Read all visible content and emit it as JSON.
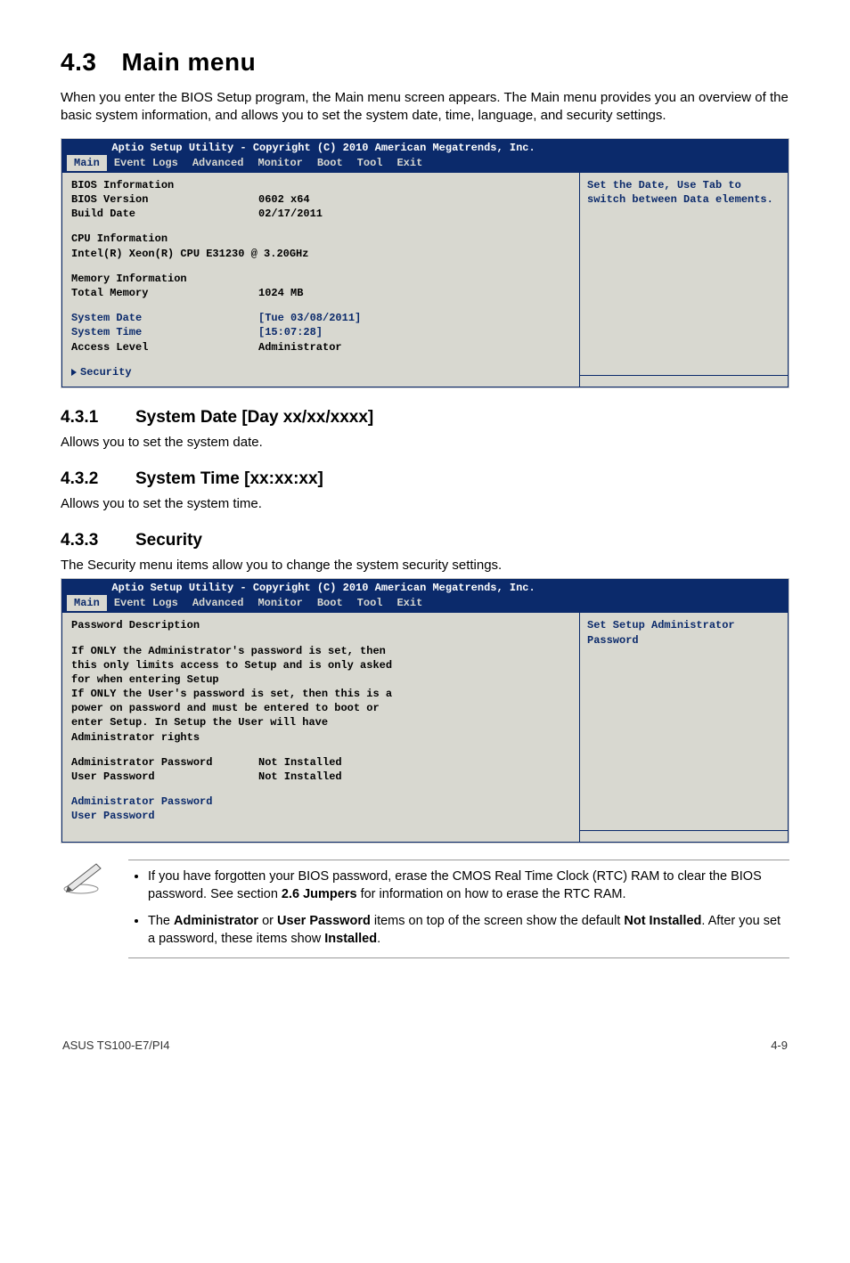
{
  "section": {
    "number": "4.3",
    "title": "Main menu",
    "intro": "When you enter the BIOS Setup program, the Main menu screen appears. The Main menu provides you an overview of the basic system information, and allows you to set the system date, time, language, and security settings."
  },
  "bios1": {
    "header": "       Aptio Setup Utility - Copyright (C) 2010 American Megatrends, Inc.",
    "tabs": [
      "Main",
      "Event Logs",
      "Advanced",
      "Monitor",
      "Boot",
      "Tool",
      "Exit"
    ],
    "selected_tab": 0,
    "help": "Set the Date, Use Tab to switch between Data elements.",
    "groups": {
      "bios_info_title": "BIOS Information",
      "bios_version_label": "BIOS Version",
      "bios_version_value": "0602 x64",
      "build_date_label": "Build Date",
      "build_date_value": "02/17/2011",
      "cpu_info_title": "CPU Information",
      "cpu_model": "Intel(R) Xeon(R) CPU E31230 @ 3.20GHz",
      "mem_info_title": "Memory Information",
      "total_mem_label": "Total Memory",
      "total_mem_value": "1024 MB",
      "system_date_label": "System Date",
      "system_date_value": "[Tue 03/08/2011]",
      "system_time_label": "System Time",
      "system_time_value": "[15:07:28]",
      "access_level_label": "Access Level",
      "access_level_value": "Administrator",
      "security_item": "Security"
    }
  },
  "sub1": {
    "num": "4.3.1",
    "title": "System Date [Day xx/xx/xxxx]",
    "text": "Allows you to set the system date."
  },
  "sub2": {
    "num": "4.3.2",
    "title": "System Time [xx:xx:xx]",
    "text": "Allows you to set the system time."
  },
  "sub3": {
    "num": "4.3.3",
    "title": "Security",
    "text": "The Security menu items allow you to change the system security settings."
  },
  "bios2": {
    "header": "       Aptio Setup Utility - Copyright (C) 2010 American Megatrends, Inc.",
    "tabs": [
      "Main",
      "Event Logs",
      "Advanced",
      "Monitor",
      "Boot",
      "Tool",
      "Exit"
    ],
    "selected_tab": 0,
    "help": "Set Setup Administrator Password",
    "body": {
      "title": "Password Description",
      "para": "If ONLY the Administrator's password is set, then this only limits access to Setup and is only asked for when entering Setup\nIf ONLY the User's password is set, then this is a power on password and must be entered to boot or enter Setup. In Setup the User will have Administrator rights",
      "admin_pw_label": "Administrator Password",
      "admin_pw_value": "Not Installed",
      "user_pw_label": "User Password",
      "user_pw_value": "Not Installed",
      "admin_pw_item": "Administrator Password",
      "user_pw_item": "User Password"
    }
  },
  "note": {
    "item1_pre": "If you have forgotten your BIOS password, erase the CMOS Real Time Clock (RTC) RAM to clear the BIOS password. See section ",
    "item1_bold": "2.6 Jumpers",
    "item1_post": " for information on how to erase the RTC RAM.",
    "item2_pre": "The ",
    "item2_b1": "Administrator",
    "item2_mid1": " or ",
    "item2_b2": "User Password",
    "item2_mid2": " items on top of the screen show the default ",
    "item2_b3": "Not Installed",
    "item2_mid3": ". After you set a password, these items show ",
    "item2_b4": "Installed",
    "item2_post": "."
  },
  "footer": {
    "left": "ASUS TS100-E7/PI4",
    "right": "4-9"
  }
}
